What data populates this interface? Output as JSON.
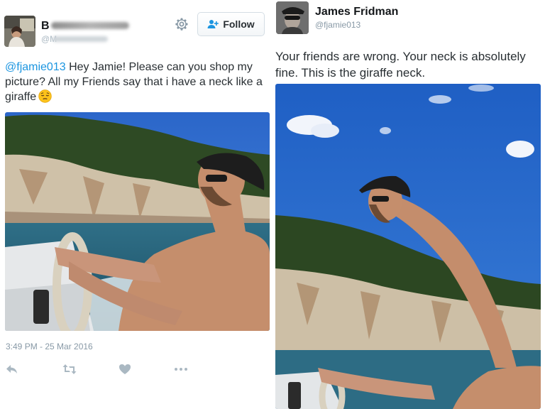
{
  "left_tweet": {
    "user": {
      "name_visible": "B",
      "handle_visible": "@M"
    },
    "follow_label": "Follow",
    "mention": "@fjamie013",
    "text": " Hey Jamie! Please can you shop my picture? All my Friends say that i have a neck like a giraffe",
    "timestamp": "3:49 PM - 25 Mar 2016",
    "icons": [
      "reply-icon",
      "retweet-icon",
      "like-icon",
      "more-icon"
    ]
  },
  "right_tweet": {
    "user": {
      "name": "James Fridman",
      "handle": "@fjamie013"
    },
    "text": "Your friends are wrong. Your neck is absolutely fine. This is the giraffe neck."
  },
  "colors": {
    "link": "#1b95e0",
    "muted": "#8899a6",
    "sky": "#2a6ec4",
    "sea": "#2f6f87"
  }
}
